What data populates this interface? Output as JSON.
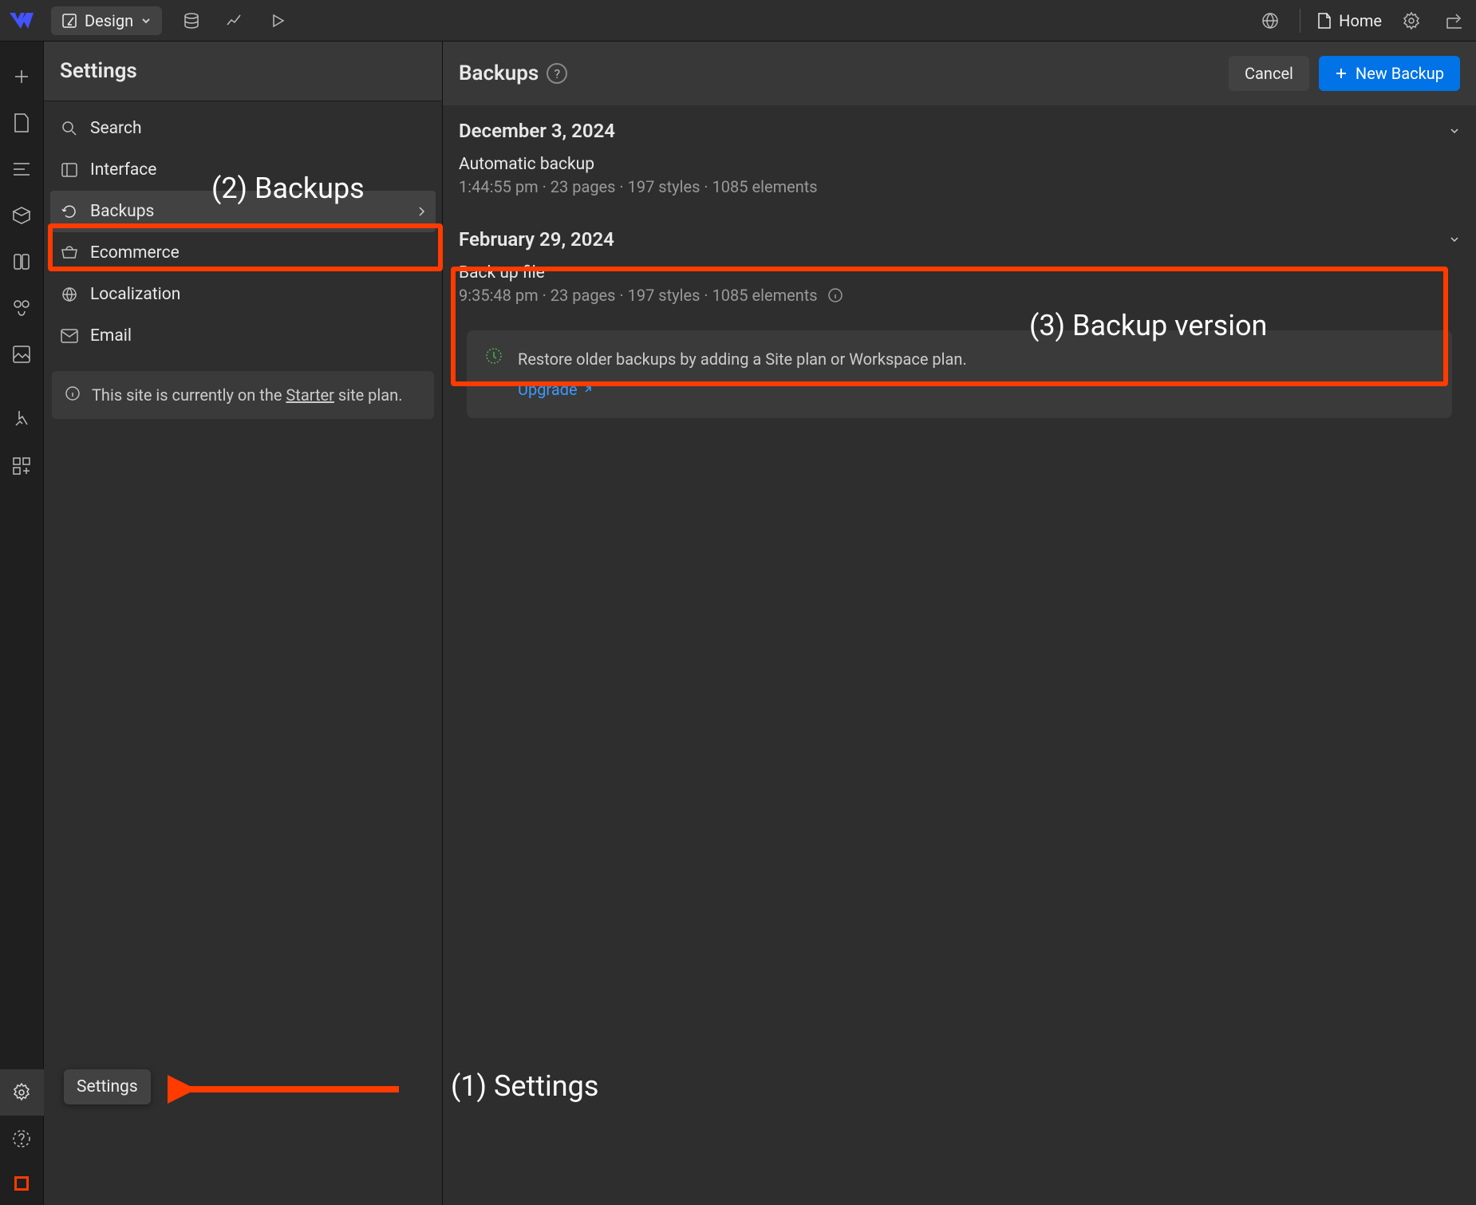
{
  "topbar": {
    "mode_label": "Design",
    "home_label": "Home"
  },
  "settings": {
    "title": "Settings",
    "items": {
      "search": "Search",
      "interface": "Interface",
      "backups": "Backups",
      "ecommerce": "Ecommerce",
      "localization": "Localization",
      "email": "Email"
    },
    "plan_notice_a": "This site is currently on the ",
    "plan_notice_b": "Starter",
    "plan_notice_c": " site plan."
  },
  "main": {
    "title": "Backups",
    "cancel": "Cancel",
    "new_backup": "New Backup",
    "groups": [
      {
        "date": "December 3, 2024",
        "name": "Automatic backup",
        "meta": "1:44:55 pm · 23 pages · 197 styles · 1085 elements"
      },
      {
        "date": "February 29, 2024",
        "name": "Back up file",
        "meta": "9:35:48 pm · 23 pages · 197 styles · 1085 elements"
      }
    ],
    "upgrade_text": "Restore older backups by adding a Site plan or Workspace plan.",
    "upgrade_link": "Upgrade"
  },
  "annotations": {
    "a1": "(1) Settings",
    "a2": "(2) Backups",
    "a3": "(3) Backup version",
    "tooltip": "Settings"
  }
}
